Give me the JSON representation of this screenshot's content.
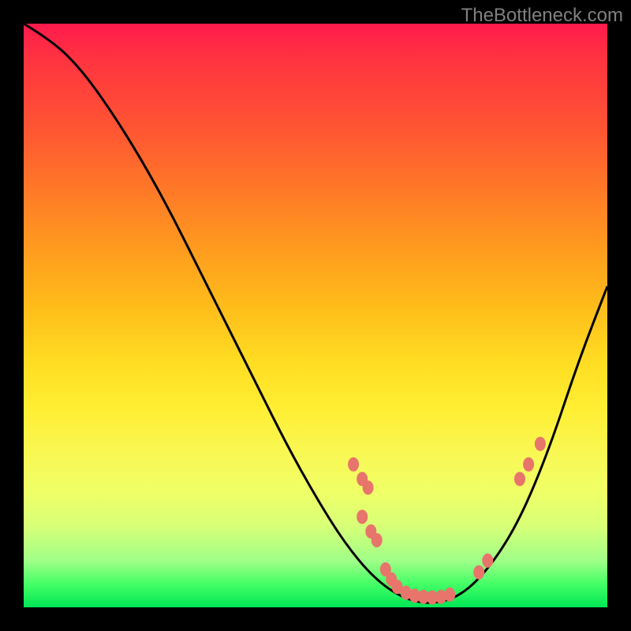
{
  "watermark": "TheBottleneck.com",
  "chart_data": {
    "type": "line",
    "title": "",
    "xlabel": "",
    "ylabel": "",
    "xlim": [
      0,
      100
    ],
    "ylim": [
      0,
      100
    ],
    "curve": [
      {
        "x": 0,
        "y": 100
      },
      {
        "x": 5,
        "y": 97
      },
      {
        "x": 10,
        "y": 92
      },
      {
        "x": 15,
        "y": 85
      },
      {
        "x": 20,
        "y": 77
      },
      {
        "x": 25,
        "y": 68
      },
      {
        "x": 30,
        "y": 58
      },
      {
        "x": 35,
        "y": 48
      },
      {
        "x": 40,
        "y": 38
      },
      {
        "x": 45,
        "y": 28
      },
      {
        "x": 50,
        "y": 19
      },
      {
        "x": 55,
        "y": 11
      },
      {
        "x": 60,
        "y": 5
      },
      {
        "x": 65,
        "y": 1.5
      },
      {
        "x": 70,
        "y": 0.5
      },
      {
        "x": 75,
        "y": 2
      },
      {
        "x": 80,
        "y": 7
      },
      {
        "x": 85,
        "y": 15
      },
      {
        "x": 90,
        "y": 27
      },
      {
        "x": 95,
        "y": 42
      },
      {
        "x": 100,
        "y": 55
      }
    ],
    "markers": [
      {
        "x": 56.5,
        "y": 24.5
      },
      {
        "x": 58,
        "y": 22
      },
      {
        "x": 59,
        "y": 20.5
      },
      {
        "x": 58,
        "y": 15.5
      },
      {
        "x": 59.5,
        "y": 13
      },
      {
        "x": 60.5,
        "y": 11.5
      },
      {
        "x": 62,
        "y": 6.5
      },
      {
        "x": 63,
        "y": 4.8
      },
      {
        "x": 64,
        "y": 3.5
      },
      {
        "x": 65.5,
        "y": 2.5
      },
      {
        "x": 67,
        "y": 2
      },
      {
        "x": 68.5,
        "y": 1.8
      },
      {
        "x": 70,
        "y": 1.7
      },
      {
        "x": 71.5,
        "y": 1.8
      },
      {
        "x": 73,
        "y": 2.2
      },
      {
        "x": 78,
        "y": 6
      },
      {
        "x": 79.5,
        "y": 8
      },
      {
        "x": 85,
        "y": 22
      },
      {
        "x": 86.5,
        "y": 24.5
      },
      {
        "x": 88.5,
        "y": 28
      }
    ],
    "marker_color": "#e8756b",
    "curve_color": "#000000"
  }
}
